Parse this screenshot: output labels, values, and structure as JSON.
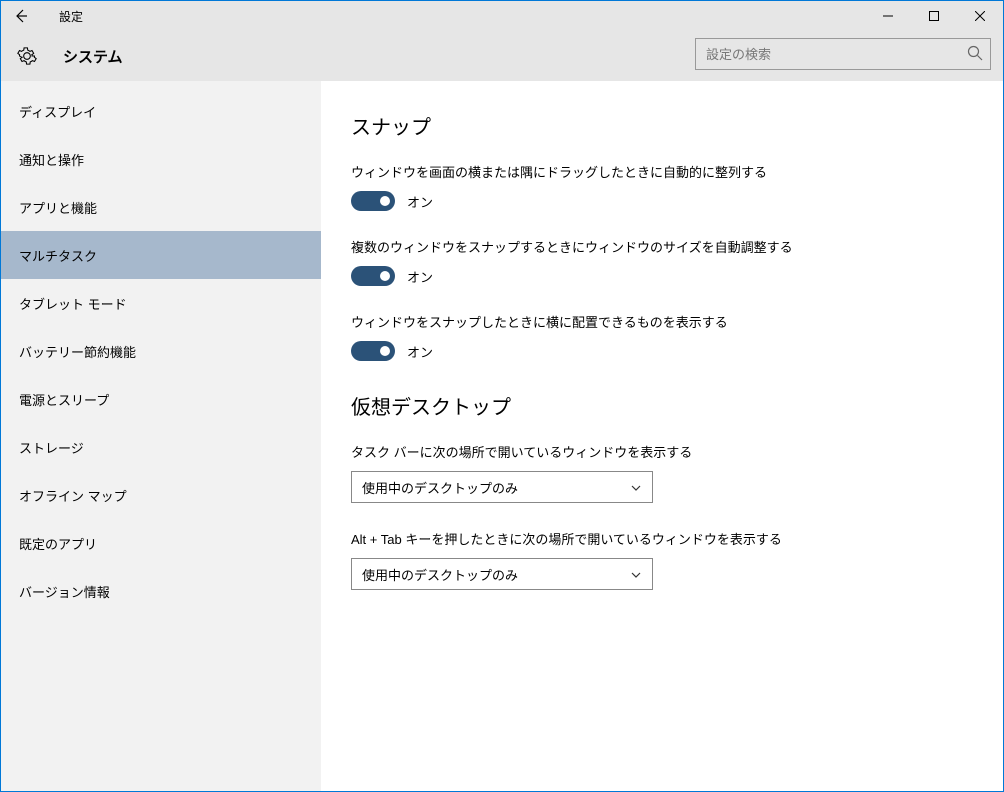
{
  "window": {
    "title": "設定"
  },
  "header": {
    "section": "システム",
    "search_placeholder": "設定の検索"
  },
  "sidebar": {
    "items": [
      {
        "label": "ディスプレイ",
        "active": false
      },
      {
        "label": "通知と操作",
        "active": false
      },
      {
        "label": "アプリと機能",
        "active": false
      },
      {
        "label": "マルチタスク",
        "active": true
      },
      {
        "label": "タブレット モード",
        "active": false
      },
      {
        "label": "バッテリー節約機能",
        "active": false
      },
      {
        "label": "電源とスリープ",
        "active": false
      },
      {
        "label": "ストレージ",
        "active": false
      },
      {
        "label": "オフライン マップ",
        "active": false
      },
      {
        "label": "既定のアプリ",
        "active": false
      },
      {
        "label": "バージョン情報",
        "active": false
      }
    ]
  },
  "content": {
    "snap": {
      "heading": "スナップ",
      "items": [
        {
          "label": "ウィンドウを画面の横または隅にドラッグしたときに自動的に整列する",
          "state": "オン",
          "on": true
        },
        {
          "label": "複数のウィンドウをスナップするときにウィンドウのサイズを自動調整する",
          "state": "オン",
          "on": true
        },
        {
          "label": "ウィンドウをスナップしたときに横に配置できるものを表示する",
          "state": "オン",
          "on": true
        }
      ]
    },
    "virtual_desktop": {
      "heading": "仮想デスクトップ",
      "taskbar": {
        "label": "タスク バーに次の場所で開いているウィンドウを表示する",
        "value": "使用中のデスクトップのみ"
      },
      "alttab": {
        "label": "Alt + Tab キーを押したときに次の場所で開いているウィンドウを表示する",
        "value": "使用中のデスクトップのみ"
      }
    }
  }
}
